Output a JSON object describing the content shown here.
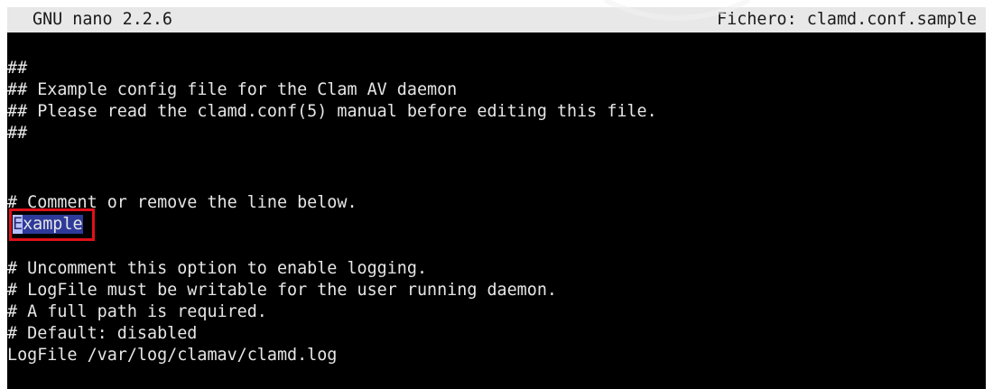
{
  "titlebar": {
    "app_name": "GNU nano 2.2.6",
    "file_label": "Fichero: clamd.conf.sample"
  },
  "buffer": {
    "lines": [
      "##",
      "## Example config file for the Clam AV daemon",
      "## Please read the clamd.conf(5) manual before editing this file.",
      "##",
      "",
      "",
      "# Comment or remove the line below.",
      "Example",
      "",
      "# Uncomment this option to enable logging.",
      "# LogFile must be writable for the user running daemon.",
      "# A full path is required.",
      "# Default: disabled",
      "LogFile /var/log/clamav/clamd.log"
    ],
    "selected_word": {
      "cursor_char": "E",
      "rest": "xample"
    }
  },
  "colors": {
    "background": "#000000",
    "text": "#e6e6e6",
    "titlebar_bg": "#e8e8e8",
    "selection_bg": "#2e3a9a",
    "highlight_box": "#e0101a"
  }
}
